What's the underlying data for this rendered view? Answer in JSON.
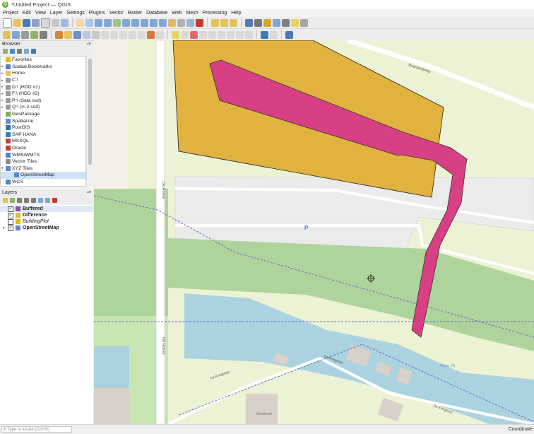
{
  "window": {
    "title": "*Untitled Project — QGIS"
  },
  "menu": [
    "Project",
    "Edit",
    "View",
    "Layer",
    "Settings",
    "Plugins",
    "Vector",
    "Raster",
    "Database",
    "Web",
    "Mesh",
    "Processing",
    "Help"
  ],
  "browser": {
    "title": "Browser",
    "items": [
      {
        "label": "Favorites",
        "icon": "star-icon",
        "arrow": "",
        "color": "#e8b800",
        "selected": false
      },
      {
        "label": "Spatial Bookmarks",
        "icon": "bookmark-icon",
        "arrow": "▸",
        "color": "#5b7ec2",
        "selected": false
      },
      {
        "label": "Home",
        "icon": "folder-icon",
        "arrow": "▸",
        "color": "#e3c15b",
        "selected": false
      },
      {
        "label": "C:\\",
        "icon": "drive-icon",
        "arrow": "▸",
        "color": "#9a9a9a",
        "selected": false
      },
      {
        "label": "D:\\ (HDD #1)",
        "icon": "drive-icon",
        "arrow": "▸",
        "color": "#9a9a9a",
        "selected": false
      },
      {
        "label": "F:\\ (HDD #2)",
        "icon": "drive-icon",
        "arrow": "▸",
        "color": "#9a9a9a",
        "selected": false
      },
      {
        "label": "P:\\ (Sata ssd)",
        "icon": "drive-icon",
        "arrow": "▸",
        "color": "#9a9a9a",
        "selected": false
      },
      {
        "label": "Q:\\ (m.2 ssd)",
        "icon": "drive-icon",
        "arrow": "▸",
        "color": "#9a9a9a",
        "selected": false
      },
      {
        "label": "GeoPackage",
        "icon": "geopackage-icon",
        "arrow": "",
        "color": "#7bb34a",
        "selected": false
      },
      {
        "label": "SpatiaLite",
        "icon": "spatialite-icon",
        "arrow": "",
        "color": "#5d8fce",
        "selected": false
      },
      {
        "label": "PostGIS",
        "icon": "postgis-icon",
        "arrow": "",
        "color": "#3d6fa8",
        "selected": false
      },
      {
        "label": "SAP HANA",
        "icon": "sap-hana-icon",
        "arrow": "",
        "color": "#2d7fc1",
        "selected": false
      },
      {
        "label": "MSSQL",
        "icon": "mssql-icon",
        "arrow": "",
        "color": "#b84a3a",
        "selected": false
      },
      {
        "label": "Oracle",
        "icon": "oracle-icon",
        "arrow": "",
        "color": "#c33b2c",
        "selected": false
      },
      {
        "label": "WMS/WMTS",
        "icon": "wms-icon",
        "arrow": "",
        "color": "#4b87c7",
        "selected": false
      },
      {
        "label": "Vector Tiles",
        "icon": "vector-tiles-icon",
        "arrow": "",
        "color": "#8a8a8a",
        "selected": false
      },
      {
        "label": "XYZ Tiles",
        "icon": "xyz-tiles-icon",
        "arrow": "▾",
        "color": "#5c89c8",
        "selected": false
      },
      {
        "label": "OpenStreetMap",
        "icon": "grid-icon",
        "arrow": "",
        "color": "#5c89c8",
        "selected": true,
        "indent": true
      },
      {
        "label": "WCS",
        "icon": "wcs-icon",
        "arrow": "",
        "color": "#4b87c7",
        "selected": false
      }
    ]
  },
  "layers": {
    "title": "Layers",
    "items": [
      {
        "label": "Buffered",
        "checked": true,
        "swatch": "#8d4f9f",
        "bold": true,
        "italic": false
      },
      {
        "label": "Difference",
        "checked": true,
        "swatch": "#e3b53c",
        "bold": true,
        "italic": false
      },
      {
        "label": "BuildingPlot",
        "checked": false,
        "swatch": "#e8b800",
        "bold": false,
        "italic": true
      },
      {
        "label": "OpenStreetMap",
        "checked": true,
        "swatch": "#5c89c8",
        "bold": true,
        "italic": false,
        "expander": "▾"
      }
    ]
  },
  "map": {
    "labels": {
      "boerderijweg": "Boerderijweg",
      "de_hoeve_1": "De Hoeve",
      "de_hoeve_2": "De Hoeve",
      "de_kringloop_1": "De Kringloop",
      "de_kringloop_2": "De Kringloop",
      "de_kringloop_3": "De Kringloop",
      "parking": "P",
      "water": "Vijver 75",
      "westhoek": "Westhoek"
    },
    "colors": {
      "difference_fill": "#e1b23f",
      "buffered_fill": "#d84083",
      "grass": "#c9e5b1",
      "forest": "#afd49b",
      "water": "#aad3df",
      "parking": "#ebebeb",
      "building": "#d9d0c9"
    }
  },
  "status": {
    "locator_placeholder": "Type to locate (Ctrl+K)",
    "coordinate_label": "Coordinate"
  }
}
